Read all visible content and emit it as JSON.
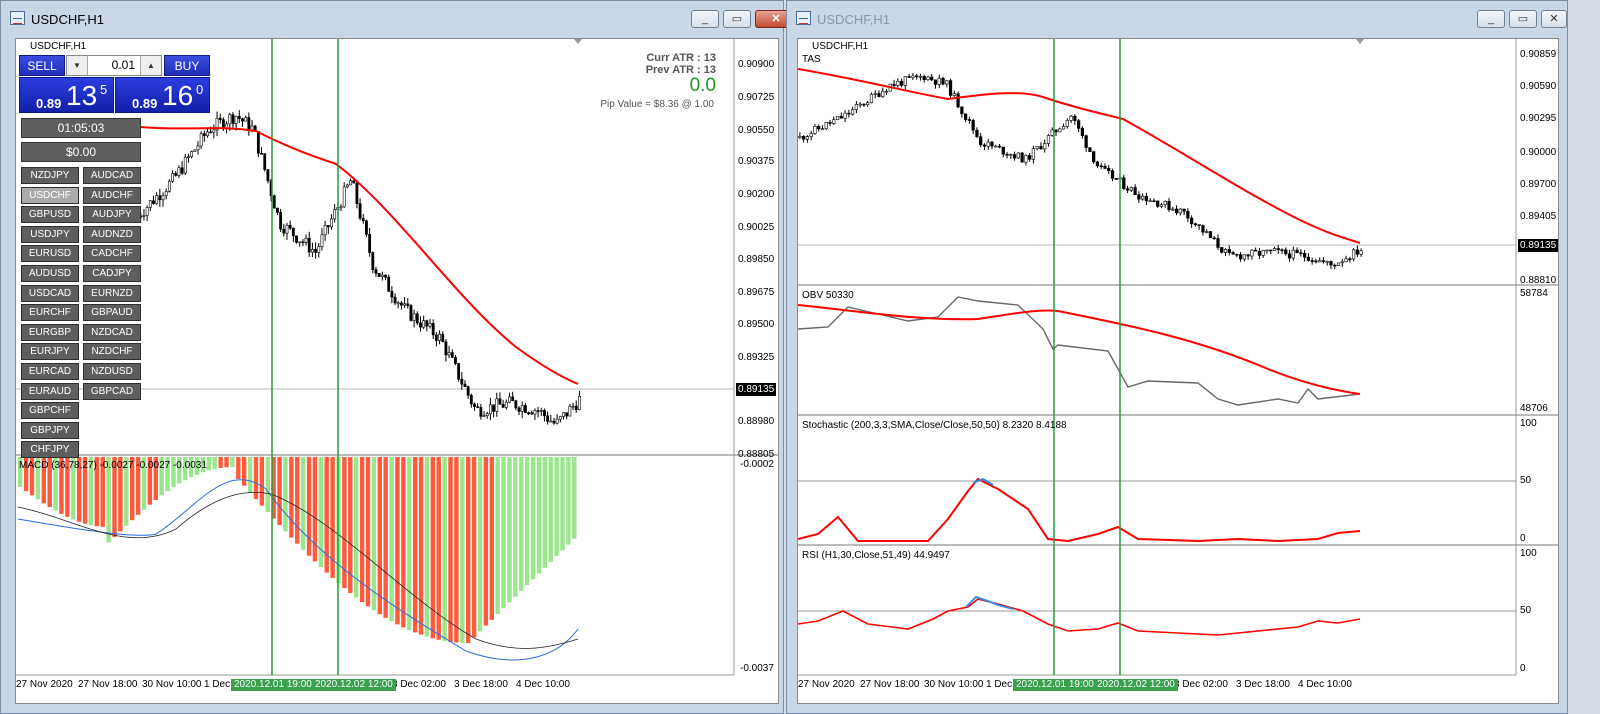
{
  "left_window": {
    "title": "USDCHF,H1",
    "buttons": {
      "minimize": "_",
      "restore": "▭",
      "close": "✕"
    },
    "chart_header": "USDCHF,H1",
    "trade_panel": {
      "sell_label": "SELL",
      "buy_label": "BUY",
      "lot": "0.01",
      "sell_small": "0.89",
      "sell_big": "13",
      "sell_sup": "5",
      "buy_small": "0.89",
      "buy_big": "16",
      "buy_sup": "0",
      "timer": "01:05:03",
      "profit": "$0.00"
    },
    "info": {
      "curr_atr": "Curr ATR : 13",
      "prev_atr": "Prev ATR : 13",
      "value": "0.0",
      "pip_value": "Pip Value = $8.36 @ 1.00"
    },
    "symbols": [
      [
        "NZDJPY",
        "AUDCAD"
      ],
      [
        "USDCHF",
        "AUDCHF"
      ],
      [
        "GBPUSD",
        "AUDJPY"
      ],
      [
        "USDJPY",
        "AUDNZD"
      ],
      [
        "EURUSD",
        "CADCHF"
      ],
      [
        "AUDUSD",
        "CADJPY"
      ],
      [
        "USDCAD",
        "EURNZD"
      ],
      [
        "EURCHF",
        "GBPAUD"
      ],
      [
        "EURGBP",
        "NZDCAD"
      ],
      [
        "EURJPY",
        "NZDCHF"
      ],
      [
        "EURCAD",
        "NZDUSD"
      ],
      [
        "EURAUD",
        "GBPCAD"
      ],
      [
        "GBPCHF"
      ],
      [
        "GBPJPY"
      ],
      [
        "CHFJPY"
      ]
    ],
    "selected_symbol": "USDCHF",
    "price_axis": [
      "0.90900",
      "0.90725",
      "0.90550",
      "0.90375",
      "0.90200",
      "0.90025",
      "0.89850",
      "0.89675",
      "0.89500",
      "0.89325",
      "0.89135",
      "0.88980",
      "0.88805"
    ],
    "current_price": "0.89135",
    "macd_label": "MACD (36,78,27) -0.0027 -0.0027 -0.0031",
    "macd_axis": [
      "-0.0002",
      "-0.0037"
    ],
    "time_axis": [
      "27 Nov 2020",
      "27 Nov 18:00",
      "30 Nov 10:00",
      "1 Dec",
      "3 Dec 02:00",
      "3 Dec 18:00",
      "4 Dec 10:00"
    ],
    "green_labels": [
      "2020.12.01 19:00",
      "2020.12.02 12:00"
    ]
  },
  "right_window": {
    "title": "USDCHF,H1",
    "buttons": {
      "minimize": "_",
      "restore": "▭",
      "close": "✕"
    },
    "chart_header": "USDCHF,H1",
    "tas_label": "TAS",
    "price_axis": [
      "0.90859",
      "0.90590",
      "0.90295",
      "0.90000",
      "0.89700",
      "0.89405",
      "0.89135",
      "0.88810"
    ],
    "current_price": "0.89135",
    "obv_label": "OBV 50330",
    "obv_axis": [
      "58784",
      "48706"
    ],
    "stoch_label": "Stochastic (200,3,3,SMA,Close/Close,50,50) 8.2320 8.4188",
    "stoch_axis": [
      "100",
      "50",
      "0"
    ],
    "rsi_label": "RSI (H1,30,Close,51,49) 44.9497",
    "rsi_axis": [
      "100",
      "50",
      "0"
    ],
    "time_axis": [
      "27 Nov 2020",
      "27 Nov 18:00",
      "30 Nov 10:00",
      "1 Dec",
      "3 Dec 02:00",
      "3 Dec 18:00",
      "4 Dec 10:00"
    ],
    "green_labels": [
      "2020.12.01 19:00",
      "2020.12.02 12:00"
    ]
  },
  "colors": {
    "ma_red": "#ff0000",
    "vline_green": "#1e9e3c",
    "hist_red": "#ff5a3c",
    "hist_green": "#9ae68c",
    "tas_blue": "#2a8ce0"
  }
}
